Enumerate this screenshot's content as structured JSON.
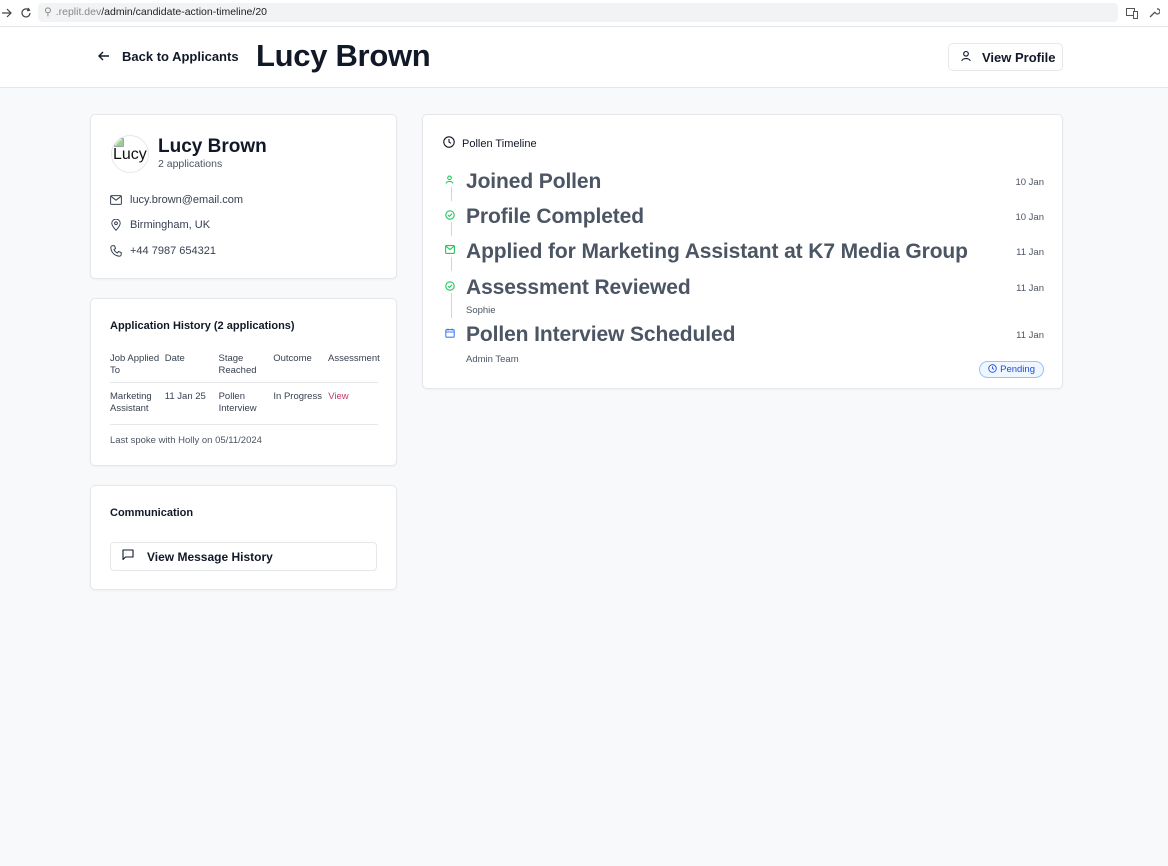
{
  "browser": {
    "url_prefix": ".replit.dev",
    "url_path": "/admin/candidate-action-timeline/20"
  },
  "header": {
    "back_label": "Back to Applicants",
    "title": "Lucy Brown",
    "view_profile_label": "View Profile"
  },
  "profile": {
    "avatar_alt": "Lucy",
    "name": "Lucy Brown",
    "applications_count": "2 applications",
    "email": "lucy.brown@email.com",
    "location": "Birmingham, UK",
    "phone": "+44 7987 654321"
  },
  "history": {
    "title": "Application History (2 applications)",
    "columns": [
      "Job Applied To",
      "Date",
      "Stage Reached",
      "Outcome",
      "Assessment"
    ],
    "rows": [
      {
        "job": "Marketing Assistant",
        "date": "11 Jan 25",
        "stage": "Pollen Interview",
        "outcome": "In Progress",
        "assessment": "View"
      }
    ],
    "last_spoke": "Last spoke with Holly on 05/11/2024"
  },
  "communication": {
    "title": "Communication",
    "button_label": "View Message History"
  },
  "timeline": {
    "title": "Pollen Timeline",
    "items": [
      {
        "icon": "user-icon",
        "title": "Joined Pollen",
        "date": "10 Jan",
        "sub": ""
      },
      {
        "icon": "check-circle-icon",
        "title": "Profile Completed",
        "date": "10 Jan",
        "sub": ""
      },
      {
        "icon": "mail-icon",
        "title": "Applied for Marketing Assistant at K7 Media Group",
        "date": "11 Jan",
        "sub": ""
      },
      {
        "icon": "check-circle-icon",
        "title": "Assessment Reviewed",
        "date": "11 Jan",
        "sub": "Sophie"
      },
      {
        "icon": "calendar-icon",
        "title": "Pollen Interview Scheduled",
        "date": "11 Jan",
        "sub": "Admin Team",
        "badge": "Pending"
      }
    ]
  },
  "colors": {
    "green": "#22c55e",
    "blue": "#3b82f6",
    "link": "#be3b6c"
  }
}
